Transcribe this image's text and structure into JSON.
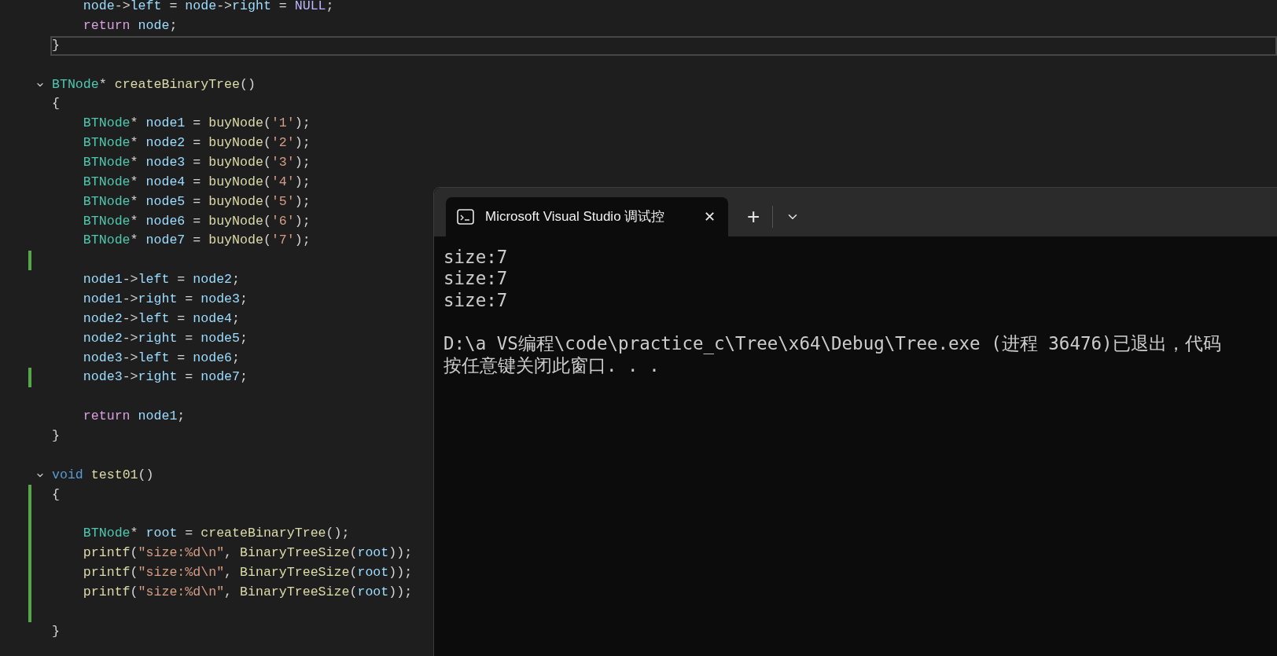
{
  "editor": {
    "lines": [
      {
        "tokens": [
          {
            "kind": "var",
            "text": "    node"
          },
          {
            "kind": "punct",
            "text": "->"
          },
          {
            "kind": "var",
            "text": "left"
          },
          {
            "kind": "punct",
            "text": " = "
          },
          {
            "kind": "var",
            "text": "node"
          },
          {
            "kind": "punct",
            "text": "->"
          },
          {
            "kind": "var",
            "text": "right"
          },
          {
            "kind": "punct",
            "text": " = "
          },
          {
            "kind": "macro",
            "text": "NULL"
          },
          {
            "kind": "punct",
            "text": ";"
          }
        ],
        "changed": false,
        "fold": false,
        "current": false
      },
      {
        "tokens": [
          {
            "kind": "ctrl",
            "text": "    return "
          },
          {
            "kind": "var",
            "text": "node"
          },
          {
            "kind": "punct",
            "text": ";"
          }
        ],
        "changed": false,
        "fold": false,
        "current": false
      },
      {
        "tokens": [
          {
            "kind": "punct",
            "text": "}"
          }
        ],
        "changed": false,
        "fold": false,
        "current": true
      },
      {
        "changed": false,
        "fold": false,
        "current": false
      },
      {
        "tokens": [
          {
            "kind": "type",
            "text": "BTNode"
          },
          {
            "kind": "punct",
            "text": "* "
          },
          {
            "kind": "func",
            "text": "createBinaryTree"
          },
          {
            "kind": "punct",
            "text": "()"
          }
        ],
        "changed": false,
        "fold": true,
        "current": false
      },
      {
        "tokens": [
          {
            "kind": "punct",
            "text": "{"
          }
        ],
        "changed": false,
        "fold": false,
        "current": false
      },
      {
        "tokens": [
          {
            "kind": "type",
            "text": "    BTNode"
          },
          {
            "kind": "punct",
            "text": "* "
          },
          {
            "kind": "var",
            "text": "node1"
          },
          {
            "kind": "punct",
            "text": " = "
          },
          {
            "kind": "func",
            "text": "buyNode"
          },
          {
            "kind": "punct",
            "text": "("
          },
          {
            "kind": "string",
            "text": "'1'"
          },
          {
            "kind": "punct",
            "text": ");"
          }
        ],
        "changed": false,
        "fold": false,
        "current": false
      },
      {
        "tokens": [
          {
            "kind": "type",
            "text": "    BTNode"
          },
          {
            "kind": "punct",
            "text": "* "
          },
          {
            "kind": "var",
            "text": "node2"
          },
          {
            "kind": "punct",
            "text": " = "
          },
          {
            "kind": "func",
            "text": "buyNode"
          },
          {
            "kind": "punct",
            "text": "("
          },
          {
            "kind": "string",
            "text": "'2'"
          },
          {
            "kind": "punct",
            "text": ");"
          }
        ],
        "changed": false,
        "fold": false,
        "current": false
      },
      {
        "tokens": [
          {
            "kind": "type",
            "text": "    BTNode"
          },
          {
            "kind": "punct",
            "text": "* "
          },
          {
            "kind": "var",
            "text": "node3"
          },
          {
            "kind": "punct",
            "text": " = "
          },
          {
            "kind": "func",
            "text": "buyNode"
          },
          {
            "kind": "punct",
            "text": "("
          },
          {
            "kind": "string",
            "text": "'3'"
          },
          {
            "kind": "punct",
            "text": ");"
          }
        ],
        "changed": false,
        "fold": false,
        "current": false
      },
      {
        "tokens": [
          {
            "kind": "type",
            "text": "    BTNode"
          },
          {
            "kind": "punct",
            "text": "* "
          },
          {
            "kind": "var",
            "text": "node4"
          },
          {
            "kind": "punct",
            "text": " = "
          },
          {
            "kind": "func",
            "text": "buyNode"
          },
          {
            "kind": "punct",
            "text": "("
          },
          {
            "kind": "string",
            "text": "'4'"
          },
          {
            "kind": "punct",
            "text": ");"
          }
        ],
        "changed": false,
        "fold": false,
        "current": false
      },
      {
        "tokens": [
          {
            "kind": "type",
            "text": "    BTNode"
          },
          {
            "kind": "punct",
            "text": "* "
          },
          {
            "kind": "var",
            "text": "node5"
          },
          {
            "kind": "punct",
            "text": " = "
          },
          {
            "kind": "func",
            "text": "buyNode"
          },
          {
            "kind": "punct",
            "text": "("
          },
          {
            "kind": "string",
            "text": "'5'"
          },
          {
            "kind": "punct",
            "text": ");"
          }
        ],
        "changed": false,
        "fold": false,
        "current": false
      },
      {
        "tokens": [
          {
            "kind": "type",
            "text": "    BTNode"
          },
          {
            "kind": "punct",
            "text": "* "
          },
          {
            "kind": "var",
            "text": "node6"
          },
          {
            "kind": "punct",
            "text": " = "
          },
          {
            "kind": "func",
            "text": "buyNode"
          },
          {
            "kind": "punct",
            "text": "("
          },
          {
            "kind": "string",
            "text": "'6'"
          },
          {
            "kind": "punct",
            "text": ");"
          }
        ],
        "changed": false,
        "fold": false,
        "current": false
      },
      {
        "tokens": [
          {
            "kind": "type",
            "text": "    BTNode"
          },
          {
            "kind": "punct",
            "text": "* "
          },
          {
            "kind": "var",
            "text": "node7"
          },
          {
            "kind": "punct",
            "text": " = "
          },
          {
            "kind": "func",
            "text": "buyNode"
          },
          {
            "kind": "punct",
            "text": "("
          },
          {
            "kind": "string",
            "text": "'7'"
          },
          {
            "kind": "punct",
            "text": ");"
          }
        ],
        "changed": false,
        "fold": false,
        "current": false
      },
      {
        "changed": true,
        "fold": false,
        "current": false
      },
      {
        "tokens": [
          {
            "kind": "var",
            "text": "    node1"
          },
          {
            "kind": "punct",
            "text": "->"
          },
          {
            "kind": "var",
            "text": "left"
          },
          {
            "kind": "punct",
            "text": " = "
          },
          {
            "kind": "var",
            "text": "node2"
          },
          {
            "kind": "punct",
            "text": ";"
          }
        ],
        "changed": false,
        "fold": false,
        "current": false
      },
      {
        "tokens": [
          {
            "kind": "var",
            "text": "    node1"
          },
          {
            "kind": "punct",
            "text": "->"
          },
          {
            "kind": "var",
            "text": "right"
          },
          {
            "kind": "punct",
            "text": " = "
          },
          {
            "kind": "var",
            "text": "node3"
          },
          {
            "kind": "punct",
            "text": ";"
          }
        ],
        "changed": false,
        "fold": false,
        "current": false
      },
      {
        "tokens": [
          {
            "kind": "var",
            "text": "    node2"
          },
          {
            "kind": "punct",
            "text": "->"
          },
          {
            "kind": "var",
            "text": "left"
          },
          {
            "kind": "punct",
            "text": " = "
          },
          {
            "kind": "var",
            "text": "node4"
          },
          {
            "kind": "punct",
            "text": ";"
          }
        ],
        "changed": false,
        "fold": false,
        "current": false
      },
      {
        "tokens": [
          {
            "kind": "var",
            "text": "    node2"
          },
          {
            "kind": "punct",
            "text": "->"
          },
          {
            "kind": "var",
            "text": "right"
          },
          {
            "kind": "punct",
            "text": " = "
          },
          {
            "kind": "var",
            "text": "node5"
          },
          {
            "kind": "punct",
            "text": ";"
          }
        ],
        "changed": false,
        "fold": false,
        "current": false
      },
      {
        "tokens": [
          {
            "kind": "var",
            "text": "    node3"
          },
          {
            "kind": "punct",
            "text": "->"
          },
          {
            "kind": "var",
            "text": "left"
          },
          {
            "kind": "punct",
            "text": " = "
          },
          {
            "kind": "var",
            "text": "node6"
          },
          {
            "kind": "punct",
            "text": ";"
          }
        ],
        "changed": false,
        "fold": false,
        "current": false
      },
      {
        "tokens": [
          {
            "kind": "var",
            "text": "    node3"
          },
          {
            "kind": "punct",
            "text": "->"
          },
          {
            "kind": "var",
            "text": "right"
          },
          {
            "kind": "punct",
            "text": " = "
          },
          {
            "kind": "var",
            "text": "node7"
          },
          {
            "kind": "punct",
            "text": ";"
          }
        ],
        "changed": true,
        "fold": false,
        "current": false
      },
      {
        "changed": false,
        "fold": false,
        "current": false
      },
      {
        "tokens": [
          {
            "kind": "ctrl",
            "text": "    return "
          },
          {
            "kind": "var",
            "text": "node1"
          },
          {
            "kind": "punct",
            "text": ";"
          }
        ],
        "changed": false,
        "fold": false,
        "current": false
      },
      {
        "tokens": [
          {
            "kind": "punct",
            "text": "}"
          }
        ],
        "changed": false,
        "fold": false,
        "current": false
      },
      {
        "changed": false,
        "fold": false,
        "current": false
      },
      {
        "tokens": [
          {
            "kind": "keyword",
            "text": "void "
          },
          {
            "kind": "func",
            "text": "test01"
          },
          {
            "kind": "punct",
            "text": "()"
          }
        ],
        "changed": false,
        "fold": true,
        "current": false
      },
      {
        "tokens": [
          {
            "kind": "punct",
            "text": "{"
          }
        ],
        "changed": true,
        "fold": false,
        "current": false
      },
      {
        "changed": true,
        "fold": false,
        "current": false
      },
      {
        "tokens": [
          {
            "kind": "type",
            "text": "    BTNode"
          },
          {
            "kind": "punct",
            "text": "* "
          },
          {
            "kind": "var",
            "text": "root"
          },
          {
            "kind": "punct",
            "text": " = "
          },
          {
            "kind": "func",
            "text": "createBinaryTree"
          },
          {
            "kind": "punct",
            "text": "();"
          }
        ],
        "changed": true,
        "fold": false,
        "current": false
      },
      {
        "tokens": [
          {
            "kind": "func",
            "text": "    printf"
          },
          {
            "kind": "punct",
            "text": "("
          },
          {
            "kind": "string",
            "text": "\"size:%d\\n\""
          },
          {
            "kind": "punct",
            "text": ", "
          },
          {
            "kind": "func",
            "text": "BinaryTreeSize"
          },
          {
            "kind": "punct",
            "text": "("
          },
          {
            "kind": "var",
            "text": "root"
          },
          {
            "kind": "punct",
            "text": "));"
          }
        ],
        "changed": true,
        "fold": false,
        "current": false
      },
      {
        "tokens": [
          {
            "kind": "func",
            "text": "    printf"
          },
          {
            "kind": "punct",
            "text": "("
          },
          {
            "kind": "string",
            "text": "\"size:%d\\n\""
          },
          {
            "kind": "punct",
            "text": ", "
          },
          {
            "kind": "func",
            "text": "BinaryTreeSize"
          },
          {
            "kind": "punct",
            "text": "("
          },
          {
            "kind": "var",
            "text": "root"
          },
          {
            "kind": "punct",
            "text": "));"
          }
        ],
        "changed": true,
        "fold": false,
        "current": false
      },
      {
        "tokens": [
          {
            "kind": "func",
            "text": "    printf"
          },
          {
            "kind": "punct",
            "text": "("
          },
          {
            "kind": "string",
            "text": "\"size:%d\\n\""
          },
          {
            "kind": "punct",
            "text": ", "
          },
          {
            "kind": "func",
            "text": "BinaryTreeSize"
          },
          {
            "kind": "punct",
            "text": "("
          },
          {
            "kind": "var",
            "text": "root"
          },
          {
            "kind": "punct",
            "text": "));"
          }
        ],
        "changed": true,
        "fold": false,
        "current": false
      },
      {
        "changed": true,
        "fold": false,
        "current": false
      },
      {
        "tokens": [
          {
            "kind": "punct",
            "text": "}"
          }
        ],
        "changed": false,
        "fold": false,
        "current": false
      }
    ]
  },
  "terminal": {
    "tab": {
      "title": "Microsoft Visual Studio 调试控",
      "close": "✕",
      "selected": true
    },
    "new_tab": "+",
    "output": [
      [
        "size:7",
        "size:7",
        "size:7"
      ],
      [
        "D:\\a VS编程\\code\\practice_c\\Tree\\x64\\Debug\\Tree.exe (进程 36476)已退出，代码",
        "按任意键关闭此窗口. . ."
      ]
    ]
  }
}
